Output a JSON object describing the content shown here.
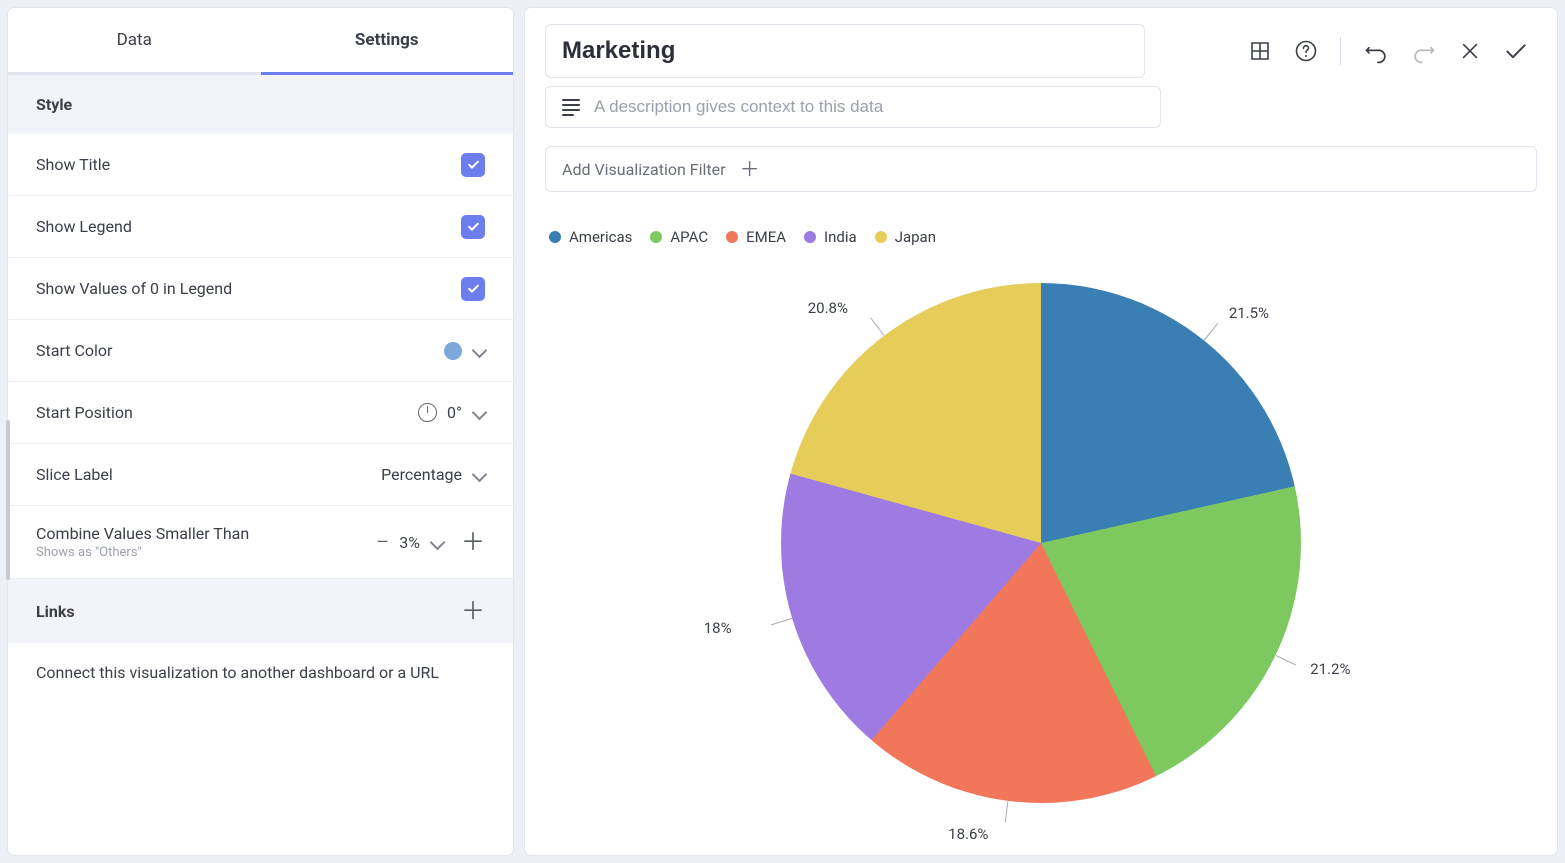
{
  "tabs": {
    "data": "Data",
    "settings": "Settings"
  },
  "style": {
    "heading": "Style",
    "show_title": "Show Title",
    "show_legend": "Show Legend",
    "show_zero": "Show Values of 0 in Legend",
    "start_color": "Start Color",
    "start_color_value": "#7da9d9",
    "start_position": "Start Position",
    "start_position_value": "0°",
    "slice_label": "Slice Label",
    "slice_label_value": "Percentage",
    "combine": "Combine Values Smaller Than",
    "combine_sub": "Shows as \"Others\"",
    "combine_value": "3%"
  },
  "links": {
    "heading": "Links",
    "desc": "Connect this visualization to another dashboard or a URL"
  },
  "header": {
    "title": "Marketing",
    "description_placeholder": "A description gives context to this data",
    "add_filter": "Add Visualization Filter"
  },
  "chart_data": {
    "type": "pie",
    "title": "Marketing",
    "slice_label_mode": "Percentage",
    "start_angle_deg": 0,
    "series": [
      {
        "name": "Americas",
        "percent": 21.5,
        "color": "#3a7fb4"
      },
      {
        "name": "APAC",
        "percent": 21.2,
        "color": "#7dc95f"
      },
      {
        "name": "EMEA",
        "percent": 18.6,
        "color": "#f1765a"
      },
      {
        "name": "India",
        "percent": 18.0,
        "color": "#9d7be3"
      },
      {
        "name": "Japan",
        "percent": 20.8,
        "color": "#e6cd5a"
      }
    ]
  }
}
